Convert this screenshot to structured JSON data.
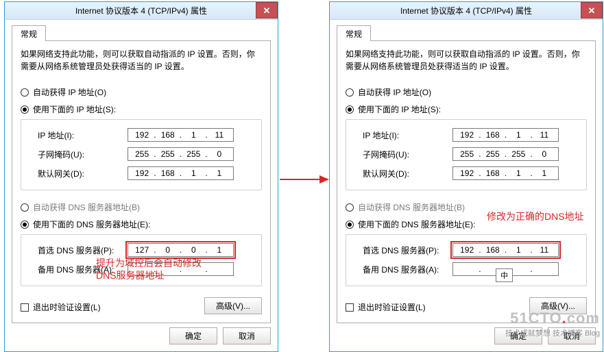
{
  "dialog_title": "Internet 协议版本 4 (TCP/IPv4) 属性",
  "close_glyph": "✕",
  "tab_label": "常规",
  "description": "如果网络支持此功能，则可以获取自动指派的 IP 设置。否则，你需要从网络系统管理员处获得适当的 IP 设置。",
  "radio_auto_ip": "自动获得 IP 地址(O)",
  "radio_manual_ip": "使用下面的 IP 地址(S):",
  "radio_auto_dns": "自动获得 DNS 服务器地址(B)",
  "radio_manual_dns": "使用下面的 DNS 服务器地址(E):",
  "label_ip": "IP 地址(I):",
  "label_mask": "子网掩码(U):",
  "label_gw": "默认网关(D):",
  "label_dns1": "首选 DNS 服务器(P):",
  "label_dns2": "备用 DNS 服务器(A):",
  "check_validate": "退出时验证设置(L)",
  "btn_adv": "高级(V)...",
  "btn_ok": "确定",
  "btn_cancel": "取消",
  "left": {
    "ip": {
      "a": "192",
      "b": "168",
      "c": "1",
      "d": "11"
    },
    "mask": {
      "a": "255",
      "b": "255",
      "c": "255",
      "d": "0"
    },
    "gw": {
      "a": "192",
      "b": "168",
      "c": "1",
      "d": "1"
    },
    "dns1": {
      "a": "127",
      "b": "0",
      "c": "0",
      "d": "1"
    },
    "dns2": {
      "a": "",
      "b": "",
      "c": "",
      "d": ""
    },
    "annot_line1": "提升为域控后会自动修改",
    "annot_line2": "DNS服务器地址"
  },
  "right": {
    "ip": {
      "a": "192",
      "b": "168",
      "c": "1",
      "d": "11"
    },
    "mask": {
      "a": "255",
      "b": "255",
      "c": "255",
      "d": "0"
    },
    "gw": {
      "a": "192",
      "b": "168",
      "c": "1",
      "d": "1"
    },
    "dns1": {
      "a": "192",
      "b": "168",
      "c": "1",
      "d": "11"
    },
    "dns2": {
      "a": "",
      "b": "",
      "c": "",
      "d": ""
    },
    "annot": "修改为正确的DNS地址"
  },
  "ime_text": "中",
  "watermark_big_pre": "51CTO",
  "watermark_big_dot": ".",
  "watermark_big_post": "com",
  "watermark_small": "技术成就梦想 技术博客 Blog"
}
